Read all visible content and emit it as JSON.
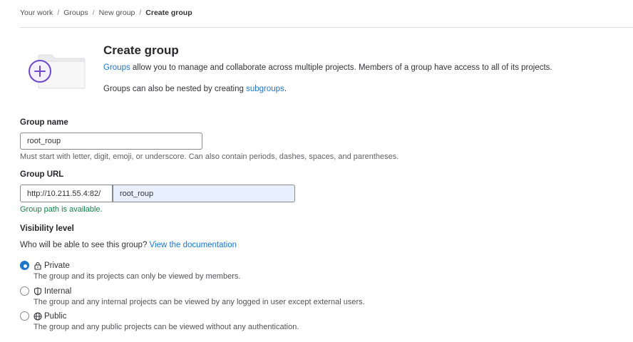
{
  "breadcrumb": [
    "Your work",
    "Groups",
    "New group",
    "Create group"
  ],
  "header": {
    "title": "Create group",
    "intro_link": "Groups",
    "intro_text": " allow you to manage and collaborate across multiple projects. Members of a group have access to all of its projects.",
    "nested_text": "Groups can also be nested by creating ",
    "nested_link": "subgroups",
    "nested_end": "."
  },
  "form": {
    "group_name_label": "Group name",
    "group_name_value": "root_roup",
    "group_name_help": "Must start with letter, digit, emoji, or underscore. Can also contain periods, dashes, spaces, and parentheses.",
    "group_url_label": "Group URL",
    "group_url_prefix": "http://10.211.55.4:82/",
    "group_url_value": "root_roup",
    "group_url_status": "Group path is available."
  },
  "visibility": {
    "label": "Visibility level",
    "question": "Who will be able to see this group? ",
    "doc_link": "View the documentation",
    "options": [
      {
        "label": "Private",
        "icon": "lock-icon",
        "desc": "The group and its projects can only be viewed by members.",
        "checked": true
      },
      {
        "label": "Internal",
        "icon": "shield-icon",
        "desc": "The group and any internal projects can be viewed by any logged in user except external users.",
        "checked": false
      },
      {
        "label": "Public",
        "icon": "globe-icon",
        "desc": "The group and any public projects can be viewed without any authentication.",
        "checked": false
      }
    ]
  },
  "colors": {
    "link": "#1f75cb",
    "success": "#108548",
    "accent": "#6e49cb"
  }
}
